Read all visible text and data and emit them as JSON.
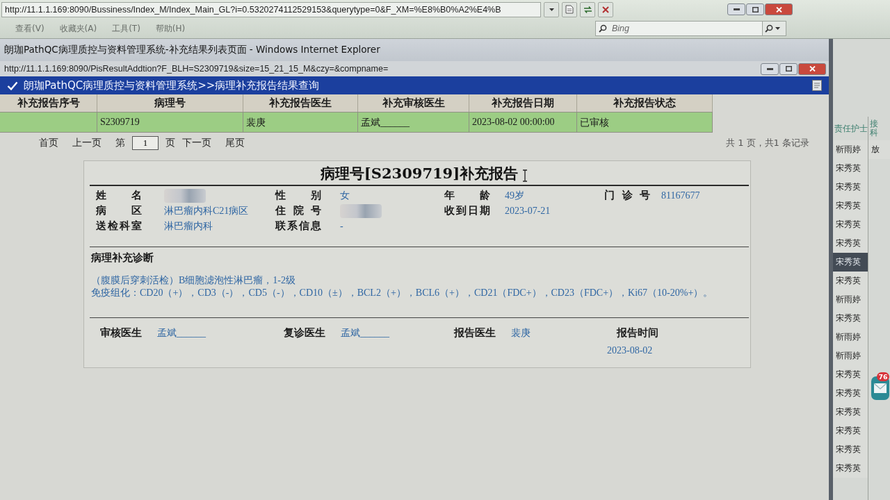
{
  "back_window": {
    "address": "http://11.1.1.169:8090/Bussiness/Index_M/Index_Main_GL?i=0.5320274112529153&querytype=0&F_XM=%E8%B0%A2%E4%B",
    "menu": [
      "查看(V)",
      "收藏夹(A)",
      "工具(T)",
      "帮助(H)"
    ],
    "search": {
      "placeholder": "Bing"
    }
  },
  "window": {
    "title": "朗珈PathQC病理质控与资料管理系统-补充结果列表页面 - Windows Internet Explorer",
    "address": "http://11.1.1.169:8090/PisResultAddtion?F_BLH=S2309719&size=15_21_15_M&czy=&compname="
  },
  "header": {
    "title": "朗珈PathQC病理质控与资料管理系统>>病理补充报告结果查询"
  },
  "table": {
    "columns": [
      "补充报告序号",
      "病理号",
      "补充报告医生",
      "补充审核医生",
      "补充报告日期",
      "补充报告状态"
    ],
    "rows": [
      {
        "selected": true,
        "cells": [
          null,
          "S2309719",
          "裴庚",
          "孟斌______",
          "2023-08-02 00:00:00",
          "已审核"
        ]
      }
    ]
  },
  "pager": {
    "items": [
      {
        "kind": "link",
        "text": "首页"
      },
      {
        "kind": "link",
        "text": "上一页"
      },
      {
        "kind": "label",
        "text": "第"
      },
      {
        "kind": "input",
        "text": "1"
      },
      {
        "kind": "label",
        "text": "页"
      },
      {
        "kind": "link",
        "text": "下一页"
      },
      {
        "kind": "link",
        "text": "尾页"
      }
    ],
    "summary": "共 1 页，共1 条记录"
  },
  "report": {
    "title": "病理号[S2309719]补充报告",
    "field_rows": [
      [
        {
          "label": "姓名",
          "redacted": true
        },
        {
          "label": "性别",
          "value": "女"
        },
        {
          "label": "年龄",
          "value": "49岁"
        },
        {
          "label": "门诊号",
          "value": "81167677"
        }
      ],
      [
        {
          "label": "病区",
          "value": "淋巴瘤内科C21病区"
        },
        {
          "label": "住院号",
          "redacted": true
        },
        {
          "label": "收到日期",
          "value": "2023-07-21"
        }
      ],
      [
        {
          "label": "送检科室",
          "value": "淋巴瘤内科"
        },
        {
          "label": "联系信息",
          "value": "-"
        }
      ]
    ],
    "diagnosis": {
      "heading": "病理补充诊断",
      "lines": [
        "（腹膜后穿刺活检）B细胞滤泡性淋巴瘤，1-2级",
        "免疫组化：CD20（+），CD3（-），CD5（-），CD10（±），BCL2（+），BCL6（+），CD21（FDC+），CD23（FDC+），Ki67（10-20%+）。"
      ]
    },
    "signatures": [
      {
        "kind": "inline",
        "label": "审核医生",
        "value": "孟斌______"
      },
      {
        "kind": "inline",
        "label": "复诊医生",
        "value": "孟斌______"
      },
      {
        "kind": "inline",
        "label": "报告医生",
        "value": "裴庚"
      },
      {
        "kind": "stacked",
        "label": "报告时间",
        "value": "2023-08-02"
      }
    ]
  },
  "side_list": {
    "columns": [
      {
        "label": "责任护士",
        "cells": [
          {
            "text": "靳雨婷",
            "selected": false
          },
          {
            "text": "宋秀英",
            "selected": false
          },
          {
            "text": "宋秀英",
            "selected": false
          },
          {
            "text": "宋秀英",
            "selected": false
          },
          {
            "text": "宋秀英",
            "selected": false
          },
          {
            "text": "宋秀英",
            "selected": false
          },
          {
            "text": "宋秀英",
            "selected": true
          },
          {
            "text": "宋秀英",
            "selected": false
          },
          {
            "text": "靳雨婷",
            "selected": false
          },
          {
            "text": "宋秀英",
            "selected": false
          },
          {
            "text": "靳雨婷",
            "selected": false
          },
          {
            "text": "靳雨婷",
            "selected": false
          },
          {
            "text": "宋秀英",
            "selected": false
          },
          {
            "text": "宋秀英",
            "selected": false
          },
          {
            "text": "宋秀英",
            "selected": false
          },
          {
            "text": "宋秀英",
            "selected": false
          },
          {
            "text": "宋秀英",
            "selected": false
          },
          {
            "text": "宋秀英",
            "selected": false
          }
        ]
      },
      {
        "label": "接科",
        "cells": [
          {
            "text": "放",
            "selected": false
          }
        ]
      }
    ]
  },
  "notification": {
    "count": "76"
  }
}
